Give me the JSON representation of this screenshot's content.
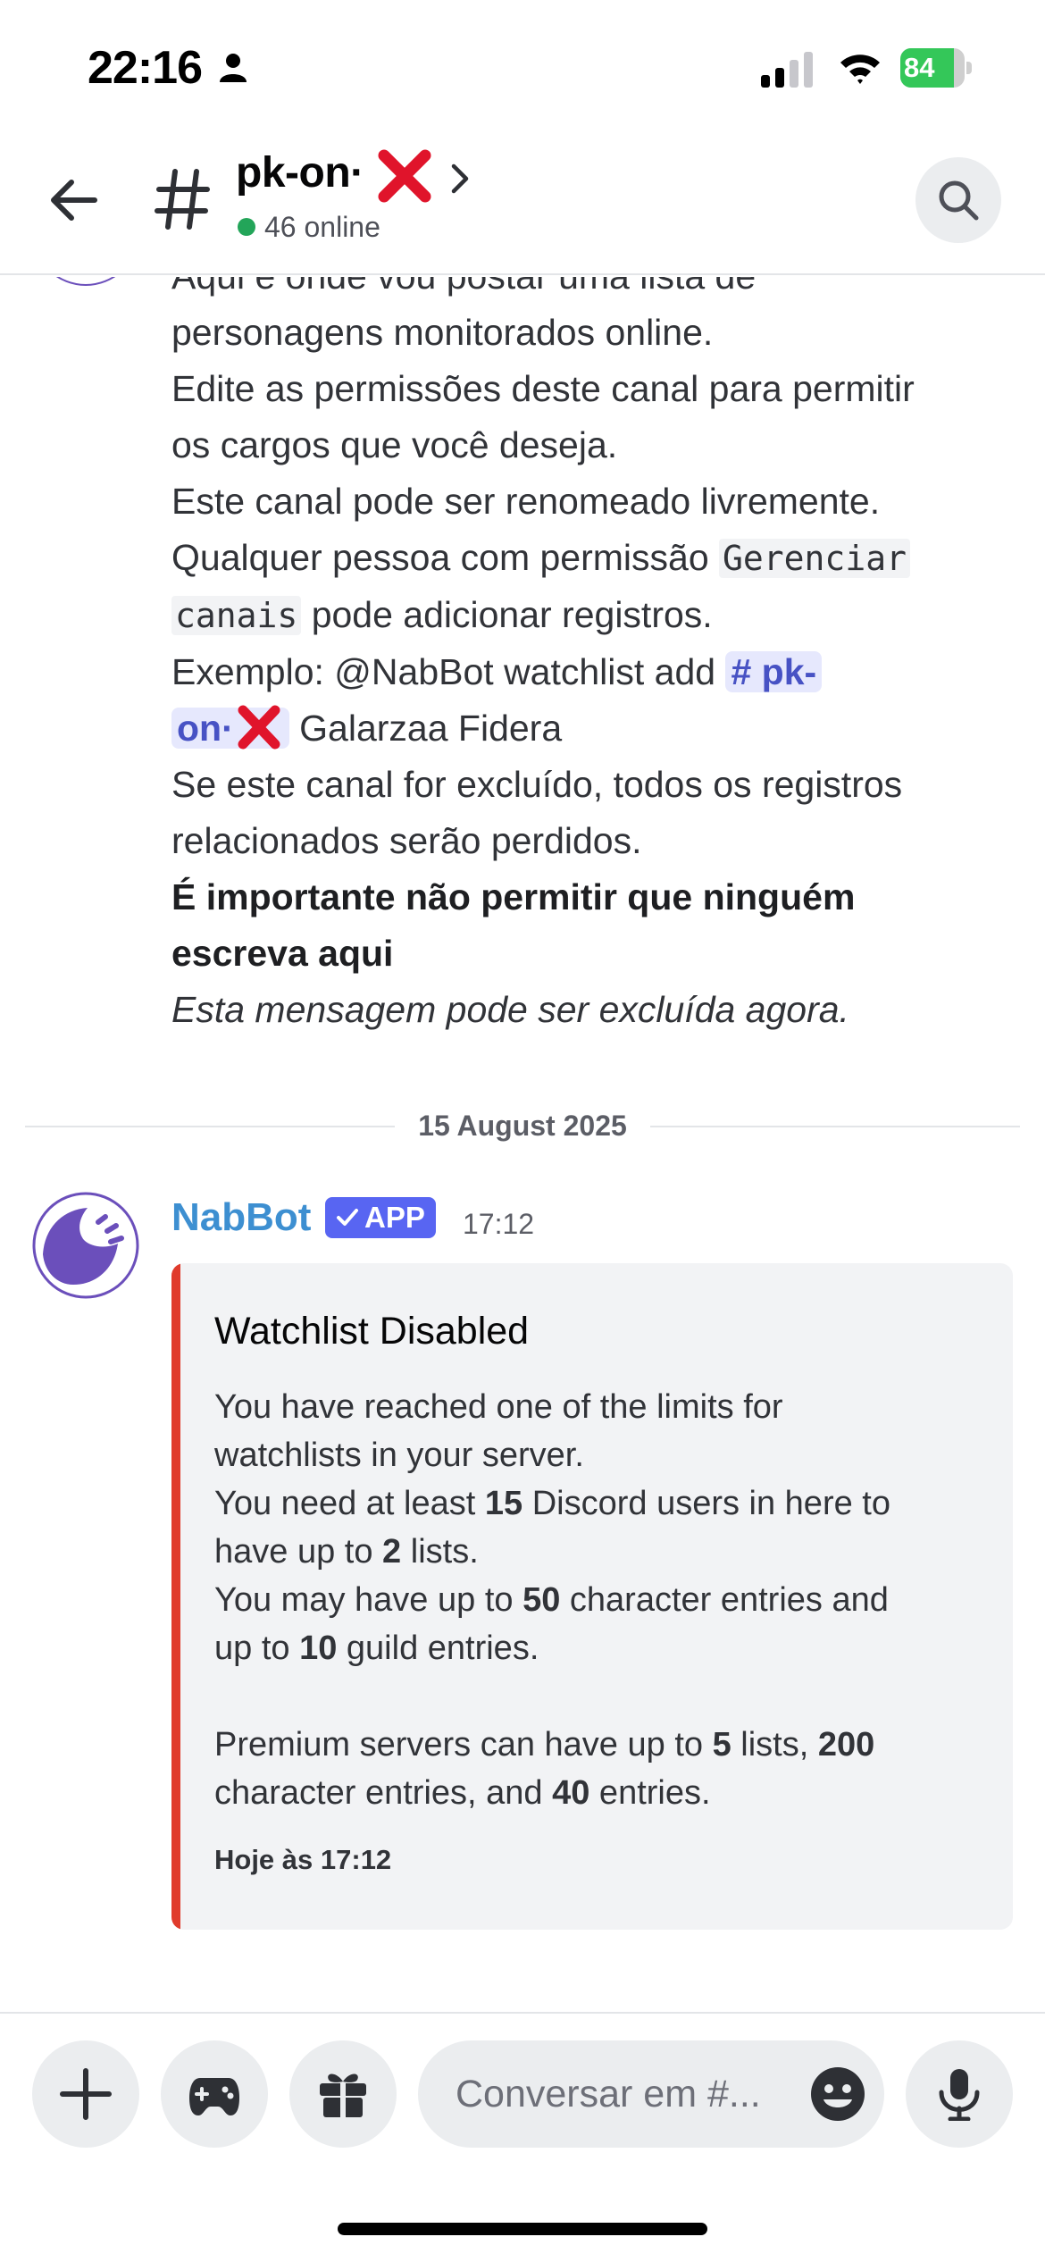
{
  "status_bar": {
    "time": "22:16",
    "battery": "84",
    "battery_level": 0.84
  },
  "header": {
    "channel_name": "pk-on·",
    "online_count": "46 online"
  },
  "old_message": {
    "lines": [
      "Aqui é onde vou postar uma lista de",
      "personagens monitorados online.",
      "Edite as permissões deste canal para permitir",
      "os cargos que você deseja.",
      "Este canal pode ser renomeado livremente.",
      "Qualquer pessoa com permissão",
      "Gerenciar",
      "canais",
      "pode adicionar registros.",
      "Exemplo: @NabBot watchlist add",
      "# pk-",
      "on·",
      "Galarzaa Fidera",
      "Se este canal for excluído, todos os registros",
      "relacionados serão perdidos.",
      "É importante não permitir que ninguém",
      "escreva aqui",
      "Esta mensagem pode ser excluída agora."
    ]
  },
  "date_divider": "15 August 2025",
  "message": {
    "author": "NabBot",
    "badge": "APP",
    "time": "17:12",
    "embed": {
      "color": "#e03b2c",
      "title": "Watchlist Disabled",
      "lines": [
        "You have reached one of the limits for",
        "watchlists in your server.",
        "You need at least ",
        "15",
        " Discord users in here to",
        "have up to ",
        "2",
        " lists.",
        "You may have up to ",
        "50",
        " character entries and",
        "up to ",
        "10",
        " guild entries.",
        "Premium servers can have up to ",
        "5",
        " lists, ",
        "200",
        "character entries, and ",
        "40",
        " entries."
      ],
      "footer": "Hoje às 17:12"
    }
  },
  "composer": {
    "placeholder": "Conversar em #..."
  },
  "icons": [
    "person-icon",
    "signal-icon",
    "wifi-icon",
    "back-icon",
    "hash-icon",
    "red-x-icon",
    "chevron-right-icon",
    "search-icon",
    "nabbot-logo-icon",
    "check-icon",
    "plus-icon",
    "gamepad-icon",
    "gift-icon",
    "emoji-icon",
    "mic-icon"
  ],
  "colors": {
    "accent": "#5865f2",
    "online": "#23a559",
    "author": "#3d8fd1",
    "embed_bar": "#e03b2c",
    "battery": "#34c759"
  }
}
